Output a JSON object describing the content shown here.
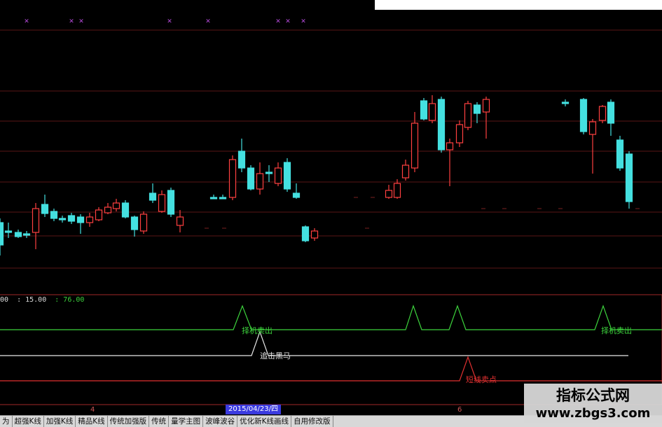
{
  "readout": {
    "v1": "00",
    "v2": ": 15.00",
    "v3": ": 76.00"
  },
  "signals": {
    "sell_label_1": "择机卖出",
    "sell_label_2": "择机卖出",
    "dark_horse_label": "追击黑马",
    "short_sell_label": "短线卖点"
  },
  "time_axis": {
    "tick_left": "4",
    "date": "2015/04/23/四",
    "tick_right": "6"
  },
  "tabs": [
    "为",
    "超强K线",
    "加强K线",
    "精品K线",
    "传统加强版",
    "传统",
    "量学主图",
    "波峰波谷",
    "优化新K线画线",
    "自用修改版"
  ],
  "watermark": {
    "title": "指标公式网",
    "url": "www.zbgs3.com"
  },
  "colors": {
    "up": "#ff4040",
    "down": "#44e0e0",
    "signal_green": "#3cd23c",
    "signal_white": "#e8e8e8",
    "signal_red": "#e03030"
  }
}
